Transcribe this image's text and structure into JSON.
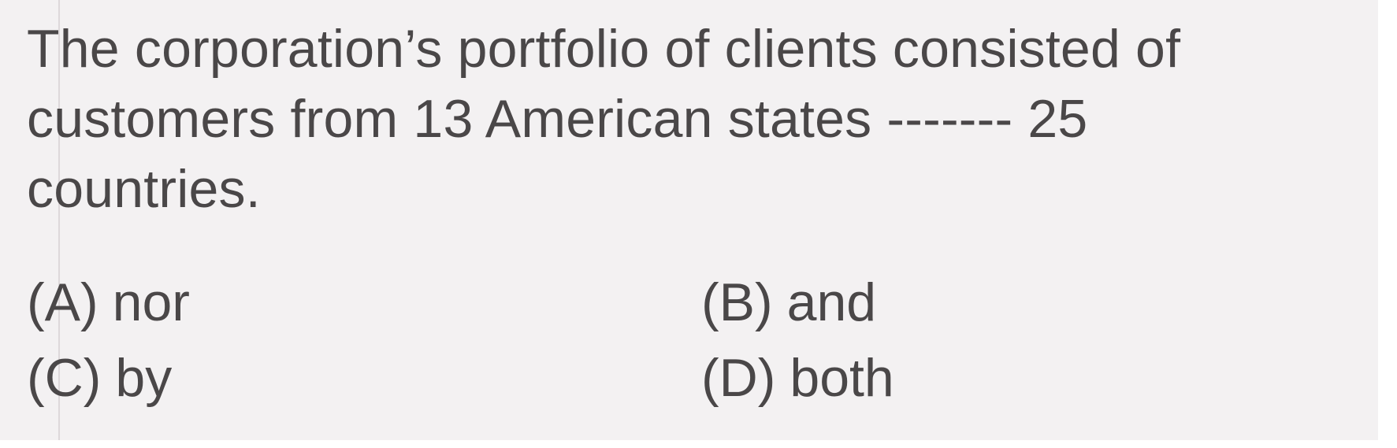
{
  "question": {
    "lines": [
      "The corporation’s portfolio of clients consisted of",
      "customers from 13 American states ------- 25",
      "countries."
    ]
  },
  "options": [
    {
      "letter": "(A)",
      "text": "nor"
    },
    {
      "letter": "(B)",
      "text": "and"
    },
    {
      "letter": "(C)",
      "text": "by"
    },
    {
      "letter": "(D)",
      "text": "both"
    }
  ],
  "colors": {
    "text": "#4a4748",
    "paper": "#f3f1f2",
    "margin": "#ffffff"
  }
}
